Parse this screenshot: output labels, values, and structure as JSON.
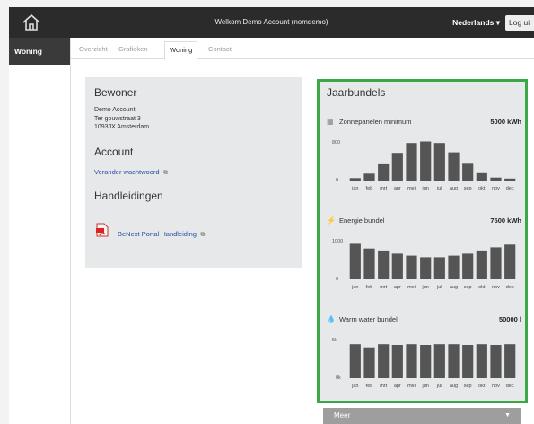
{
  "header": {
    "welcome": "Welkom Demo Account (nomdemo)",
    "language": "Nederlands ▾",
    "logout": "Log ui"
  },
  "sidebar": {
    "items": [
      {
        "label": "Woning",
        "active": true
      }
    ]
  },
  "tabs": [
    {
      "label": "Overzicht",
      "active": false
    },
    {
      "label": "Grafieken",
      "active": false
    },
    {
      "label": "Woning",
      "active": true
    },
    {
      "label": "Contact",
      "active": false
    }
  ],
  "resident": {
    "title": "Bewoner",
    "name": "Demo Account",
    "street": "Ter gouwstraat 3",
    "city": "1093JX Amsterdam"
  },
  "account": {
    "title": "Account",
    "change_password": "Verander wachtwoord",
    "ext_icon": "⧉"
  },
  "manuals": {
    "title": "Handleidingen",
    "link": "BeNext Portal Handleiding"
  },
  "bundels": {
    "title": "Jaarbundels",
    "more": "Meer",
    "more_caret": "▼",
    "accent": "#3aa847"
  },
  "chart_data": [
    {
      "type": "bar",
      "title": "Zonnepanelen minimum",
      "amount": "5000 kWh",
      "icon": "solar-panel-icon",
      "categories": [
        "jan",
        "feb",
        "mrt",
        "apr",
        "mei",
        "jun",
        "jul",
        "aug",
        "sep",
        "okt",
        "nov",
        "dec"
      ],
      "values": [
        50,
        140,
        330,
        560,
        760,
        790,
        760,
        570,
        340,
        150,
        60,
        40
      ],
      "ylim": [
        0,
        800
      ],
      "yticks": [
        "800",
        "0"
      ]
    },
    {
      "type": "bar",
      "title": "Energie bundel",
      "amount": "7500 kWh",
      "icon": "lightning-icon",
      "categories": [
        "jan",
        "feb",
        "mrt",
        "apr",
        "mei",
        "jun",
        "jul",
        "aug",
        "sep",
        "okt",
        "nov",
        "dec"
      ],
      "values": [
        900,
        780,
        730,
        650,
        600,
        560,
        560,
        600,
        650,
        730,
        810,
        880
      ],
      "ylim": [
        0,
        1000
      ],
      "yticks": [
        "1000",
        "0"
      ]
    },
    {
      "type": "bar",
      "title": "Warm water bundel",
      "amount": "50000 l",
      "icon": "water-drop-icon",
      "categories": [
        "jan",
        "feb",
        "mrt",
        "apr",
        "mei",
        "jun",
        "jul",
        "aug",
        "sep",
        "okt",
        "nov",
        "dec"
      ],
      "values": [
        4300,
        3900,
        4300,
        4200,
        4300,
        4200,
        4300,
        4300,
        4200,
        4300,
        4200,
        4300
      ],
      "ylim": [
        0,
        5000
      ],
      "yticks": [
        "5k",
        "0k"
      ]
    }
  ]
}
